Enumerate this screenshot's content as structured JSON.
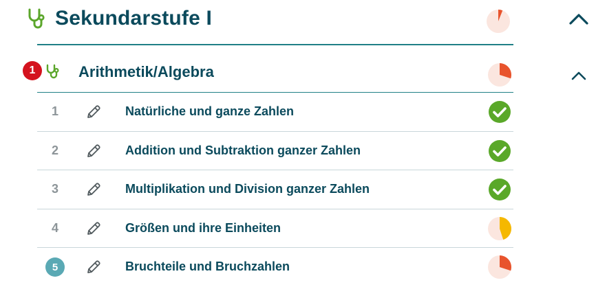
{
  "section": {
    "title": "Sekundarstufe I",
    "progress_color": "#e8542d",
    "progress_fraction": 0.06
  },
  "subsection": {
    "badge": "1",
    "title": "Arithmetik/Algebra",
    "progress_color": "#e8542d",
    "progress_fraction": 0.3
  },
  "rows": [
    {
      "num": "1",
      "title": "Natürliche und ganze Zahlen",
      "status": "done"
    },
    {
      "num": "2",
      "title": "Addition und Subtraktion ganzer Zahlen",
      "status": "done"
    },
    {
      "num": "3",
      "title": "Multiplikation und Division ganzer Zahlen",
      "status": "done"
    },
    {
      "num": "4",
      "title": "Größen und ihre Einheiten",
      "status": "partial",
      "progress_fraction": 0.45
    },
    {
      "num": "5",
      "title": "Bruchteile und Bruchzahlen",
      "status": "partial",
      "progress_fraction": 0.3,
      "num_badge": true
    }
  ],
  "colors": {
    "primary_text": "#0b4a5c",
    "accent_green": "#5ba62b",
    "done_green": "#5aa829",
    "partial_yellow": "#f5b800",
    "partial_orange": "#e8542d",
    "pie_bg": "#fbe6df",
    "badge_red": "#d4131e",
    "badge_teal": "#5aa9b4"
  },
  "icons": {
    "section": "stethoscope-icon",
    "row": "pencil-icon",
    "collapse": "chevron-up-icon",
    "done": "check-circle-icon"
  }
}
